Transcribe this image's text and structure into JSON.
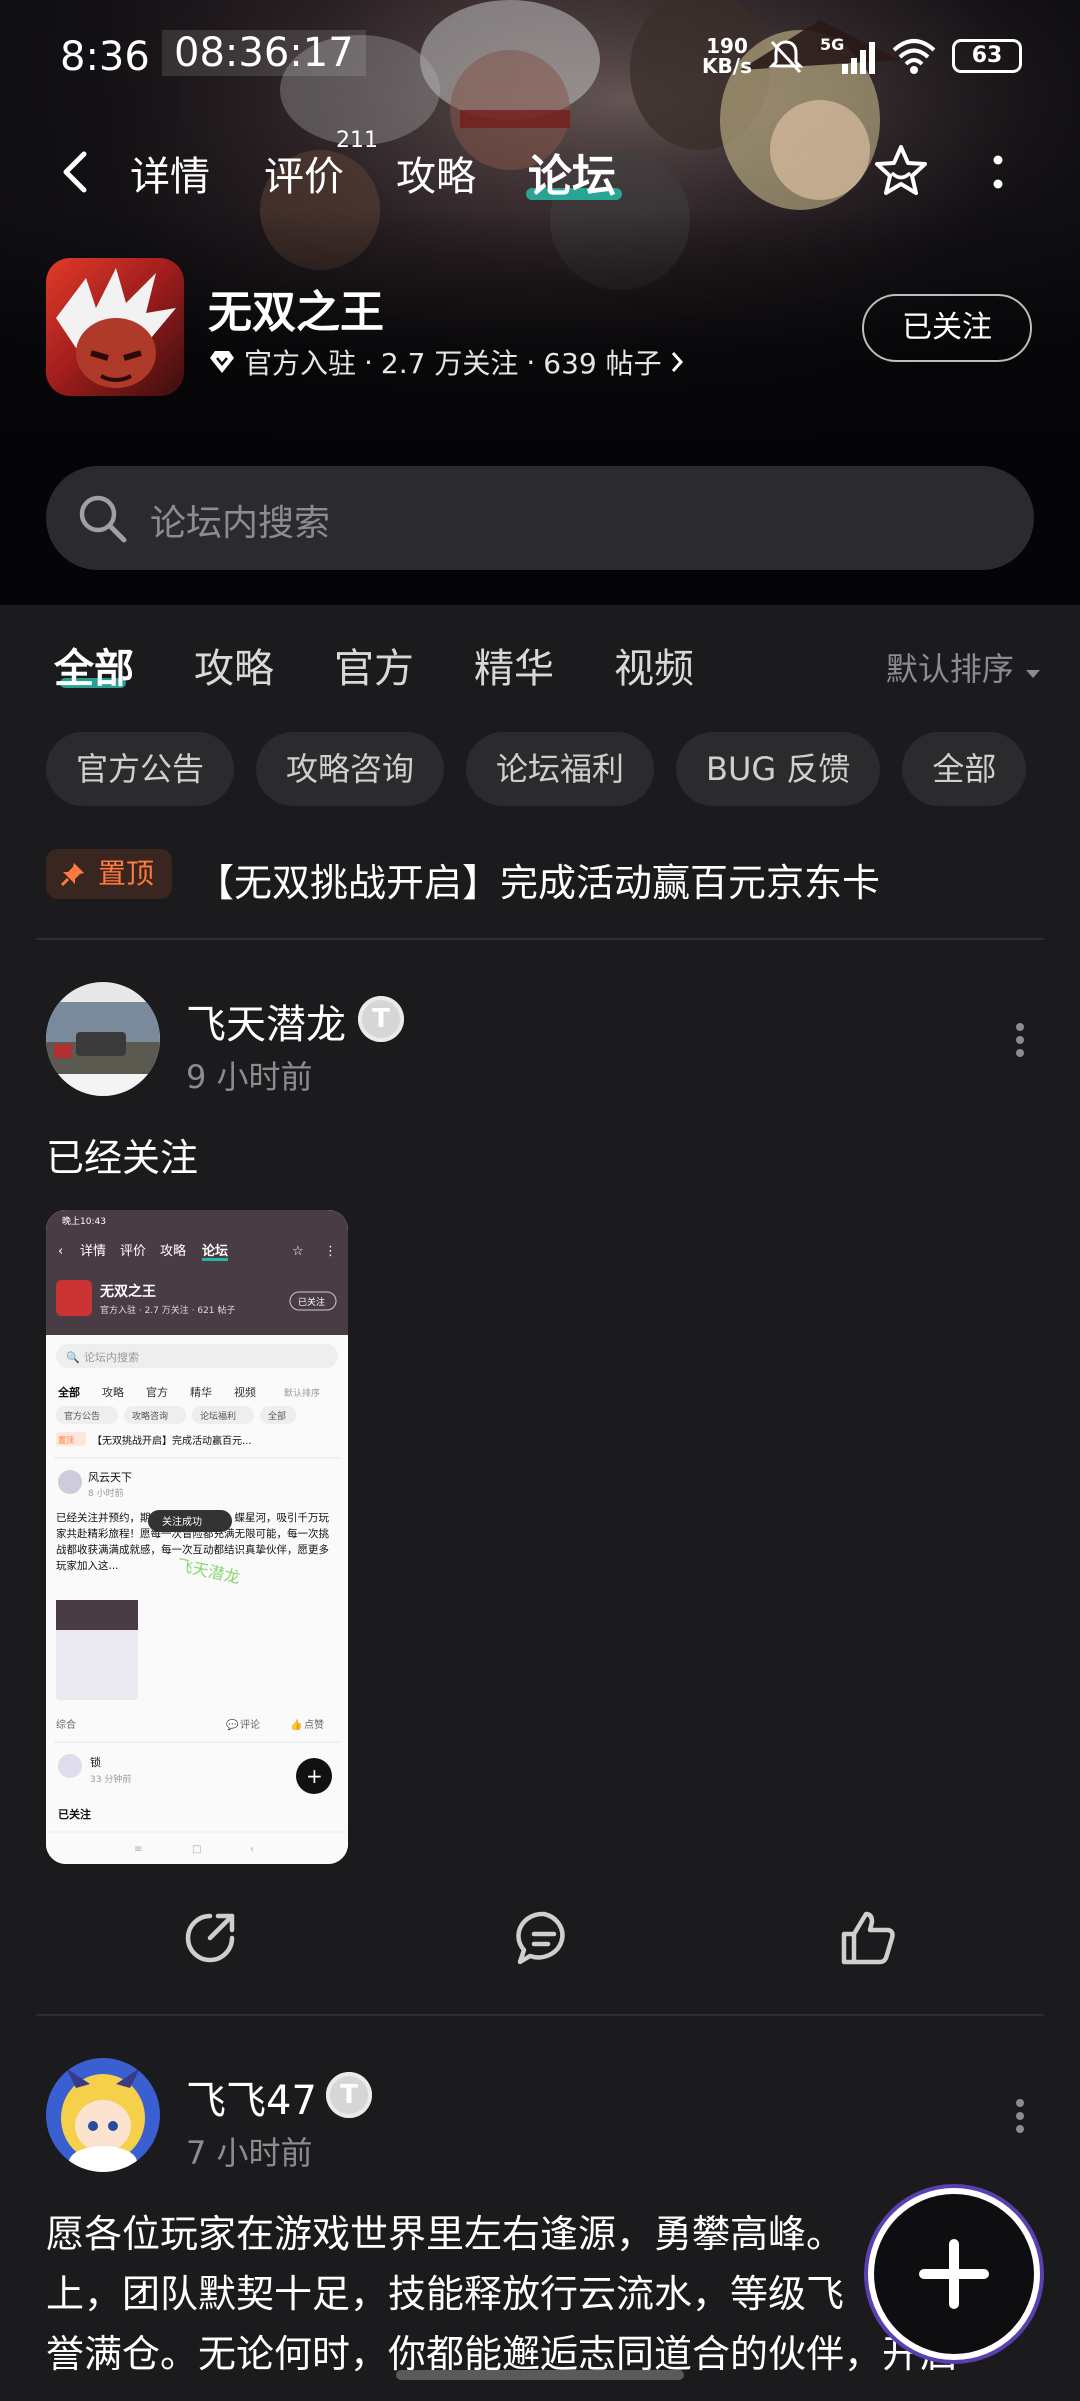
{
  "status_bar": {
    "time": "8:36",
    "clock_overlay": "08:36:17",
    "net_speed_value": "190",
    "net_speed_unit": "KB/s",
    "network": "5G",
    "battery": "63"
  },
  "nav": {
    "tabs": [
      {
        "label": "详情"
      },
      {
        "label": "评价",
        "badge": "211"
      },
      {
        "label": "攻略"
      },
      {
        "label": "论坛",
        "active": true
      }
    ]
  },
  "game": {
    "name": "无双之王",
    "meta_official": "官方入驻",
    "meta_followers": "2.7 万关注",
    "meta_posts": "639 帖子",
    "follow_button": "已关注"
  },
  "search": {
    "placeholder": "论坛内搜索"
  },
  "filter_tabs": [
    "全部",
    "攻略",
    "官方",
    "精华",
    "视频"
  ],
  "sort_label": "默认排序",
  "chips": [
    "官方公告",
    "攻略咨询",
    "论坛福利",
    "BUG 反馈",
    "全部"
  ],
  "pinned": {
    "badge": "置顶",
    "title": "【无双挑战开启】完成活动赢百元京东卡"
  },
  "posts": [
    {
      "username": "飞天潜龙",
      "level": "T",
      "time": "9 小时前",
      "text": "已经关注"
    },
    {
      "username": "飞飞47",
      "level": "T",
      "time": "7 小时前",
      "text_lines": [
        "愿各位玩家在游戏世界里左右逢源，勇攀高峰。",
        "上，团队默契十足，技能释放行云流水，等级飞",
        "誉满仓。无论何时，你都能邂逅志同道合的伙伴，开启"
      ]
    }
  ],
  "thumbnail": {
    "status_time": "晚上10:43",
    "nav_tabs": [
      "详情",
      "评价",
      "攻略",
      "论坛"
    ],
    "game_name": "无双之王",
    "meta": "官方入驻 · 2.7 万关注 · 621 帖子",
    "follow": "已关注",
    "search": "论坛内搜索",
    "tabs": [
      "全部",
      "攻略",
      "官方",
      "精华",
      "视频"
    ],
    "sort": "默认排序",
    "chips": [
      "官方公告",
      "攻略咨询",
      "论坛福利",
      "全部"
    ],
    "pinned_badge": "置顶",
    "pinned": "【无双挑战开启】完成活动赢百元...",
    "user": "风云天下",
    "time": "8 小时前",
    "body": "已经关注并预约，期待踏上星辰大海，蝶星河，吸引千万玩家共赴精彩旅程！愿每一次冒险都充满无限可能，每一次挑战都收获满满成就感，每一次互动都结识真挚伙伴，愿更多玩家加入这...",
    "toast": "关注成功",
    "watermark": "飞天潜龙",
    "footer_left": "综合",
    "footer_comment": "评论",
    "footer_like": "点赞",
    "user2": "锁",
    "time2": "33 分钟前",
    "text2": "已关注"
  },
  "colors": {
    "accent": "#27b7a6",
    "pin": "#ff7a3d",
    "background": "#1b1b1d"
  }
}
